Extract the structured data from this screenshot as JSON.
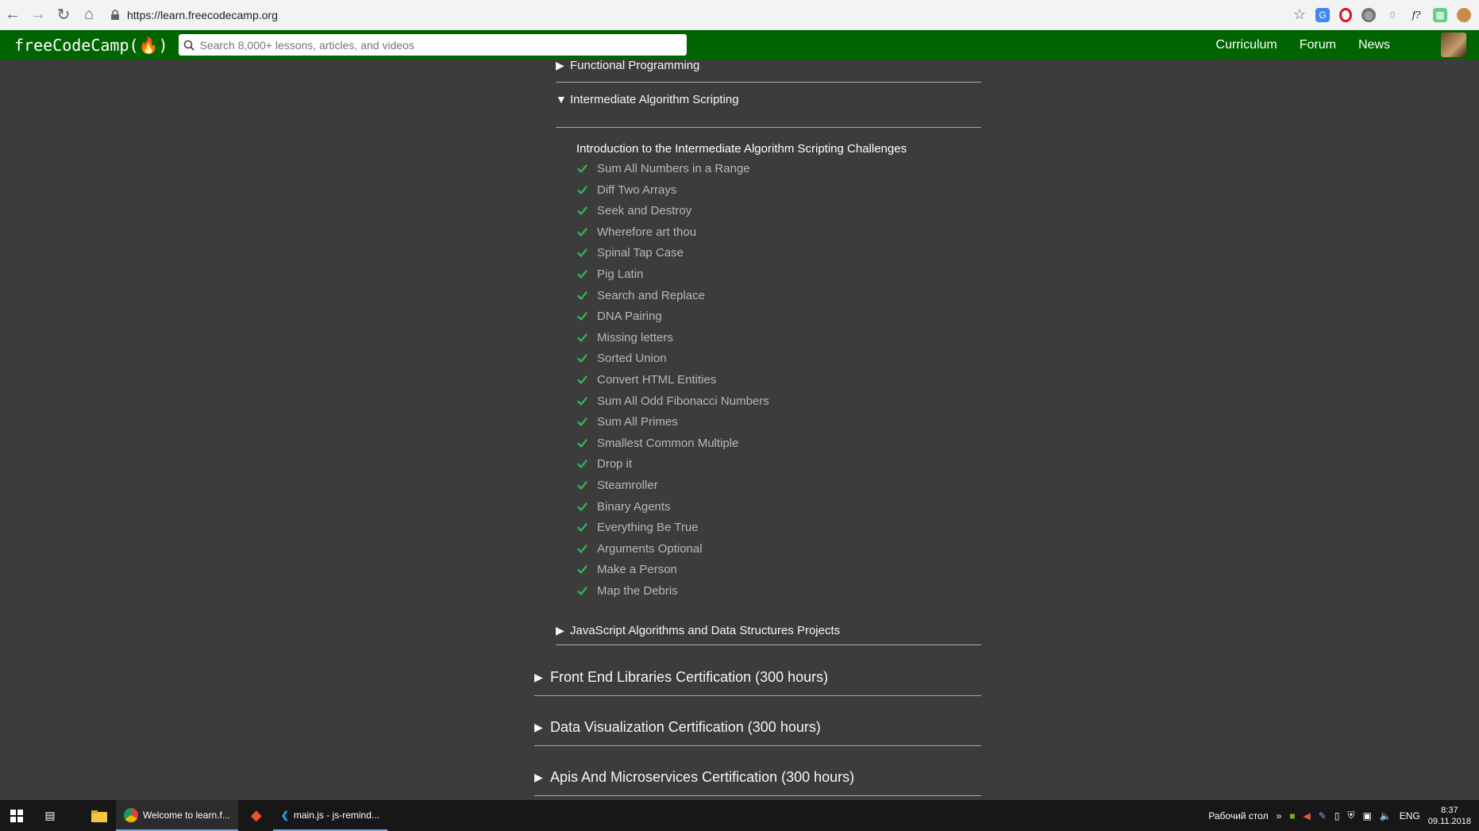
{
  "browser": {
    "url": "https://learn.freecodecamp.org"
  },
  "navbar": {
    "logo_text": "freeCodeCamp",
    "logo_flame": "(🔥)",
    "search_placeholder": "Search 8,000+ lessons, articles, and videos",
    "links": [
      "Curriculum",
      "Forum",
      "News"
    ]
  },
  "map": {
    "prev_block": "Functional Programming",
    "open_block": {
      "title": "Intermediate Algorithm Scripting",
      "intro": "Introduction to the Intermediate Algorithm Scripting Challenges",
      "challenges": [
        "Sum All Numbers in a Range",
        "Diff Two Arrays",
        "Seek and Destroy",
        "Wherefore art thou",
        "Spinal Tap Case",
        "Pig Latin",
        "Search and Replace",
        "DNA Pairing",
        "Missing letters",
        "Sorted Union",
        "Convert HTML Entities",
        "Sum All Odd Fibonacci Numbers",
        "Sum All Primes",
        "Smallest Common Multiple",
        "Drop it",
        "Steamroller",
        "Binary Agents",
        "Everything Be True",
        "Arguments Optional",
        "Make a Person",
        "Map the Debris"
      ]
    },
    "next_block": "JavaScript Algorithms and Data Structures Projects",
    "certifications": [
      "Front End Libraries Certification (300 hours)",
      "Data Visualization Certification (300 hours)",
      "Apis And Microservices Certification (300 hours)"
    ]
  },
  "taskbar": {
    "tasks": [
      "Welcome to learn.f...",
      "main.js - js-remind..."
    ],
    "desktop_label": "Рабочий стол",
    "lang": "ENG",
    "time": "8:37",
    "date": "09.11.2018"
  },
  "colors": {
    "navbar": "#006400",
    "page_bg": "#3c3c3c",
    "check": "#2db553"
  }
}
